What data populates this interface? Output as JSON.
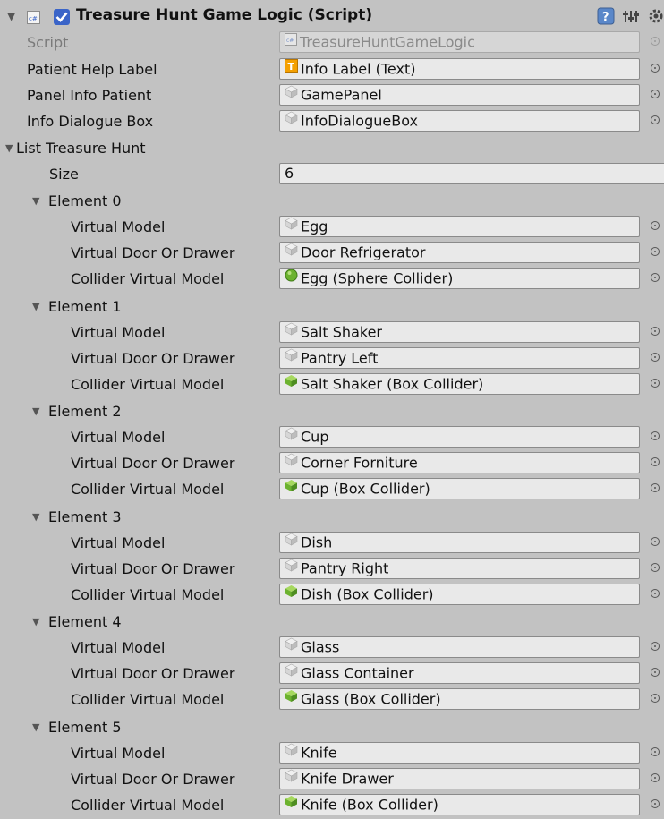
{
  "component": {
    "title": "Treasure Hunt Game Logic (Script)",
    "enabled": true
  },
  "script": {
    "label": "Script",
    "value": "TreasureHuntGameLogic"
  },
  "fields": [
    {
      "label": "Patient Help Label",
      "value": "Info Label (Text)",
      "icon": "text-component-icon"
    },
    {
      "label": "Panel Info Patient",
      "value": "GamePanel",
      "icon": "gameobject-icon"
    },
    {
      "label": "Info Dialogue Box",
      "value": "InfoDialogueBox",
      "icon": "gameobject-icon"
    }
  ],
  "list": {
    "label": "List Treasure Hunt",
    "size_label": "Size",
    "size_value": "6",
    "elements": [
      {
        "label": "Element 0",
        "virtual_model": "Egg",
        "door": "Door Refrigerator",
        "collider": "Egg (Sphere Collider)",
        "collider_icon": "sphere-collider-icon"
      },
      {
        "label": "Element 1",
        "virtual_model": "Salt Shaker",
        "door": "Pantry Left",
        "collider": "Salt Shaker (Box Collider)",
        "collider_icon": "box-collider-icon"
      },
      {
        "label": "Element 2",
        "virtual_model": "Cup",
        "door": "Corner Forniture",
        "collider": "Cup (Box Collider)",
        "collider_icon": "box-collider-icon"
      },
      {
        "label": "Element 3",
        "virtual_model": "Dish",
        "door": "Pantry Right",
        "collider": "Dish (Box Collider)",
        "collider_icon": "box-collider-icon"
      },
      {
        "label": "Element 4",
        "virtual_model": "Glass",
        "door": "Glass Container",
        "collider": "Glass (Box Collider)",
        "collider_icon": "box-collider-icon"
      },
      {
        "label": "Element 5",
        "virtual_model": "Knife",
        "door": "Knife Drawer",
        "collider": "Knife (Box Collider)",
        "collider_icon": "box-collider-icon"
      }
    ],
    "item_labels": {
      "virtual_model": "Virtual Model",
      "door": "Virtual Door Or Drawer",
      "collider": "Collider Virtual Model"
    }
  },
  "colors": {
    "background": "#c2c2c2",
    "field": "#e9e9e9",
    "checkbox": "#3a64c8",
    "collider_green": "#7cc23a"
  }
}
